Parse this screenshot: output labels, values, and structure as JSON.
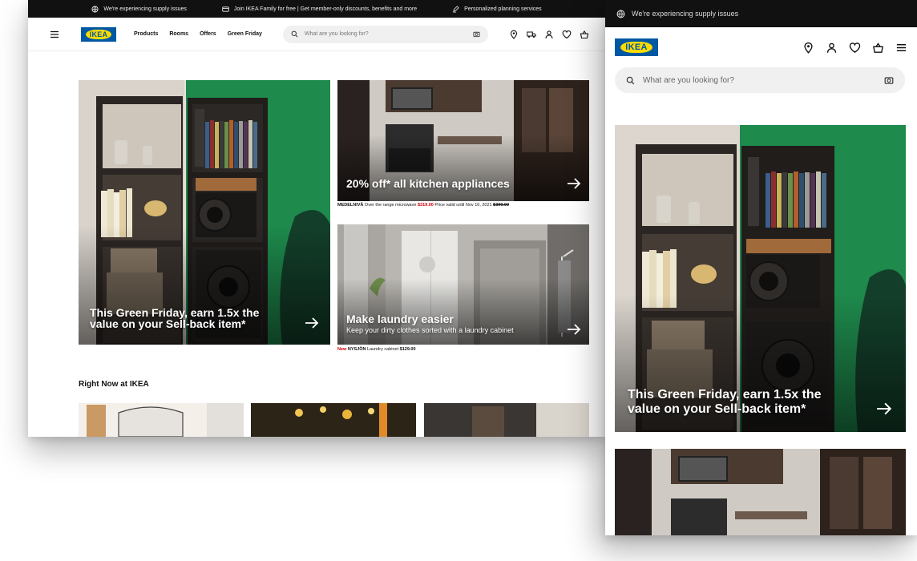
{
  "desktop": {
    "topbar": {
      "items": [
        "We're experiencing supply issues",
        "Join IKEA Family for free | Get member-only discounts, benefits and more",
        "Personalized planning services"
      ]
    },
    "nav": {
      "logo": "IKEA",
      "menu": [
        "Products",
        "Rooms",
        "Offers",
        "Green Friday"
      ],
      "search_placeholder": "What are you looking for?"
    },
    "hero": {
      "title_line1": "This Green Friday, earn 1.5x the",
      "title_line2": "value on your Sell-back item*"
    },
    "kitchen": {
      "title": "20% off* all kitchen appliances",
      "caption_name": "MEDELNIVÅ",
      "caption_desc": " Over the range microwave ",
      "caption_price": "$319.00",
      "caption_valid": " Price valid until Nov 10, 2021 ",
      "caption_old_price": "$399.00"
    },
    "laundry": {
      "title": "Make laundry easier",
      "subtitle": "Keep your dirty clothes sorted with a laundry cabinet",
      "caption_new": "New",
      "caption_name": " NYSJÖN",
      "caption_desc": " Laundry cabinet ",
      "caption_price": "$129.00"
    },
    "section_title": "Right Now at IKEA"
  },
  "mobile": {
    "topbar_text": "We're experiencing supply issues",
    "logo": "IKEA",
    "search_placeholder": "What are you looking for?",
    "hero": {
      "title_line1": "This Green Friday, earn 1.5x the",
      "title_line2": "value on your Sell-back item*"
    }
  },
  "colors": {
    "ikea_blue": "#0058a3",
    "ikea_yellow": "#ffdb00",
    "hero_green": "#1f8a4f",
    "sale_red": "#cc0008"
  }
}
